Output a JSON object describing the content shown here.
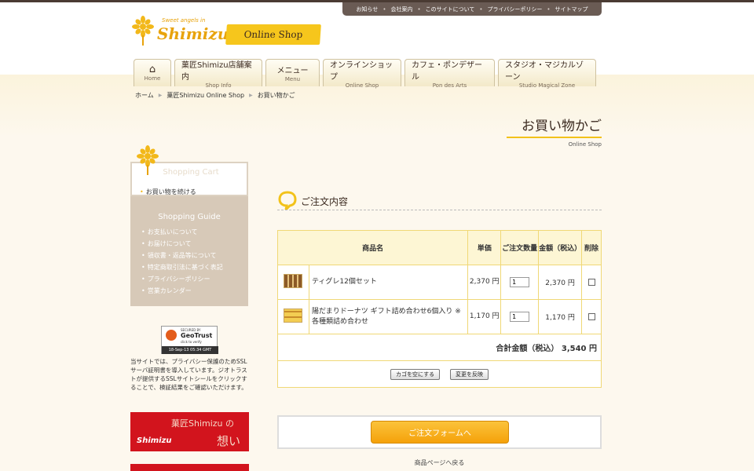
{
  "util_nav": [
    "お知らせ",
    "会社案内",
    "このサイトについて",
    "プライバシーポリシー",
    "サイトマップ"
  ],
  "logo": {
    "tagline": "Sweet angels in",
    "name": "Shimizu",
    "ribbon": "Online Shop"
  },
  "gnav": [
    {
      "jp": "",
      "en": "Home",
      "icon": "home-icon"
    },
    {
      "jp": "菓匠Shimizu店舗案内",
      "en": "Shop Info"
    },
    {
      "jp": "メニュー",
      "en": "Menu"
    },
    {
      "jp": "オンラインショップ",
      "en": "Online Shop"
    },
    {
      "jp": "カフェ・ポンデザール",
      "en": "Pon des Arts"
    },
    {
      "jp": "スタジオ・マジカルゾーン",
      "en": "Studio Magical Zone"
    }
  ],
  "breadcrumb": [
    "ホーム",
    "菓匠Shimizu Online Shop",
    "お買い物かご"
  ],
  "page_title": {
    "title": "お買い物かご",
    "subtitle": "Online Shop"
  },
  "sidebar": {
    "cart_heading": "Shopping Cart",
    "cart_link": "お買い物を続ける",
    "guide_heading": "Shopping Guide",
    "guide_items": [
      "お支払いについて",
      "お届けについて",
      "領収書・返品等について",
      "特定商取引法に基づく表記",
      "プライバシーポリシー",
      "営業カレンダー"
    ],
    "geotrust": {
      "secured_by": "SECURED BY",
      "brand": "GeoTrust",
      "click": "click to verify",
      "date": "18-Sep-13 05:34 GMT"
    },
    "ssl_text": "当サイトでは、プライバシー保護のためSSLサーバ証明書を導入しています。ジオトラストが提供するSSLサイトシールをクリックすることで、検証結果をご確認いただけます。",
    "banner": {
      "title": "菓匠Shimizu の",
      "word": "想い",
      "logo": "Shimizu"
    }
  },
  "order": {
    "heading": "ご注文内容",
    "columns": [
      "商品名",
      "単価",
      "ご注文数量",
      "金額（税込）",
      "削除"
    ],
    "items": [
      {
        "name": "ティグレ12個セット",
        "price": "2,370 円",
        "qty": "1",
        "amount": "2,370 円"
      },
      {
        "name": "陽だまりドーナツ ギフト詰め合わせ6個入り ※各種類詰め合わせ",
        "price": "1,170 円",
        "qty": "1",
        "amount": "1,170 円"
      }
    ],
    "total_label": "合計金額（税込）",
    "total_value": "3,540 円",
    "btn_empty": "カゴを空にする",
    "btn_update": "変更を反映"
  },
  "form_button": "ご注文フォームへ",
  "back_link": "商品ページへ戻る",
  "colors": {
    "accent": "#f2c21a",
    "brown": "#6a5b54",
    "banner_red": "#d2141d"
  }
}
